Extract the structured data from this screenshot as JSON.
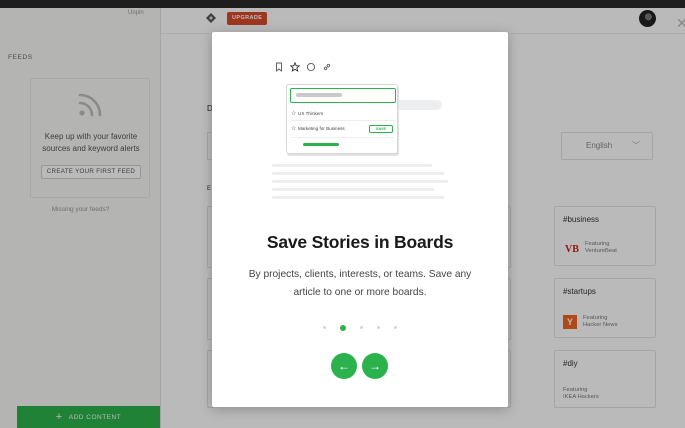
{
  "sidebar": {
    "unpin_label": "Unpin",
    "feeds_label": "FEEDS",
    "feed_text_line1": "Keep up with your favorite",
    "feed_text_line2": "sources and keyword alerts",
    "create_feed_label": "CREATE YOUR FIRST FEED",
    "missing_feeds": "Missing your feeds?",
    "add_content_label": "ADD CONTENT"
  },
  "header": {
    "upgrade_label": "UPGRADE"
  },
  "main": {
    "language_value": "English",
    "stub_letter_1": "D",
    "stub_letter_2": "E",
    "cards": [
      {
        "title": "#business",
        "featuring": "Featuring",
        "source": "VentureBeat",
        "badge": "VB"
      },
      {
        "title": "#startups",
        "featuring": "Featuring",
        "source": "Hacker News",
        "badge": "Y"
      },
      {
        "title": "#diy",
        "featuring": "Featuring",
        "source": "IKEA Hackers"
      }
    ]
  },
  "modal": {
    "popup": {
      "row1": "UX Thinkers",
      "row2": "Marketing for Business",
      "save_label": "SAVE"
    },
    "title": "Save Stories in Boards",
    "body": "By projects, clients, interests, or teams. Save any article to one or more boards.",
    "pagination": {
      "total": 5,
      "active_index": 1
    }
  },
  "colors": {
    "accent_green": "#2bb24c",
    "upgrade_red": "#d9492b",
    "overlay": "rgba(0,0,0,0.27)"
  },
  "icons": {
    "feed": "rss-icon",
    "prev": "arrow-left-icon",
    "next": "arrow-right-icon",
    "close": "close-icon"
  }
}
